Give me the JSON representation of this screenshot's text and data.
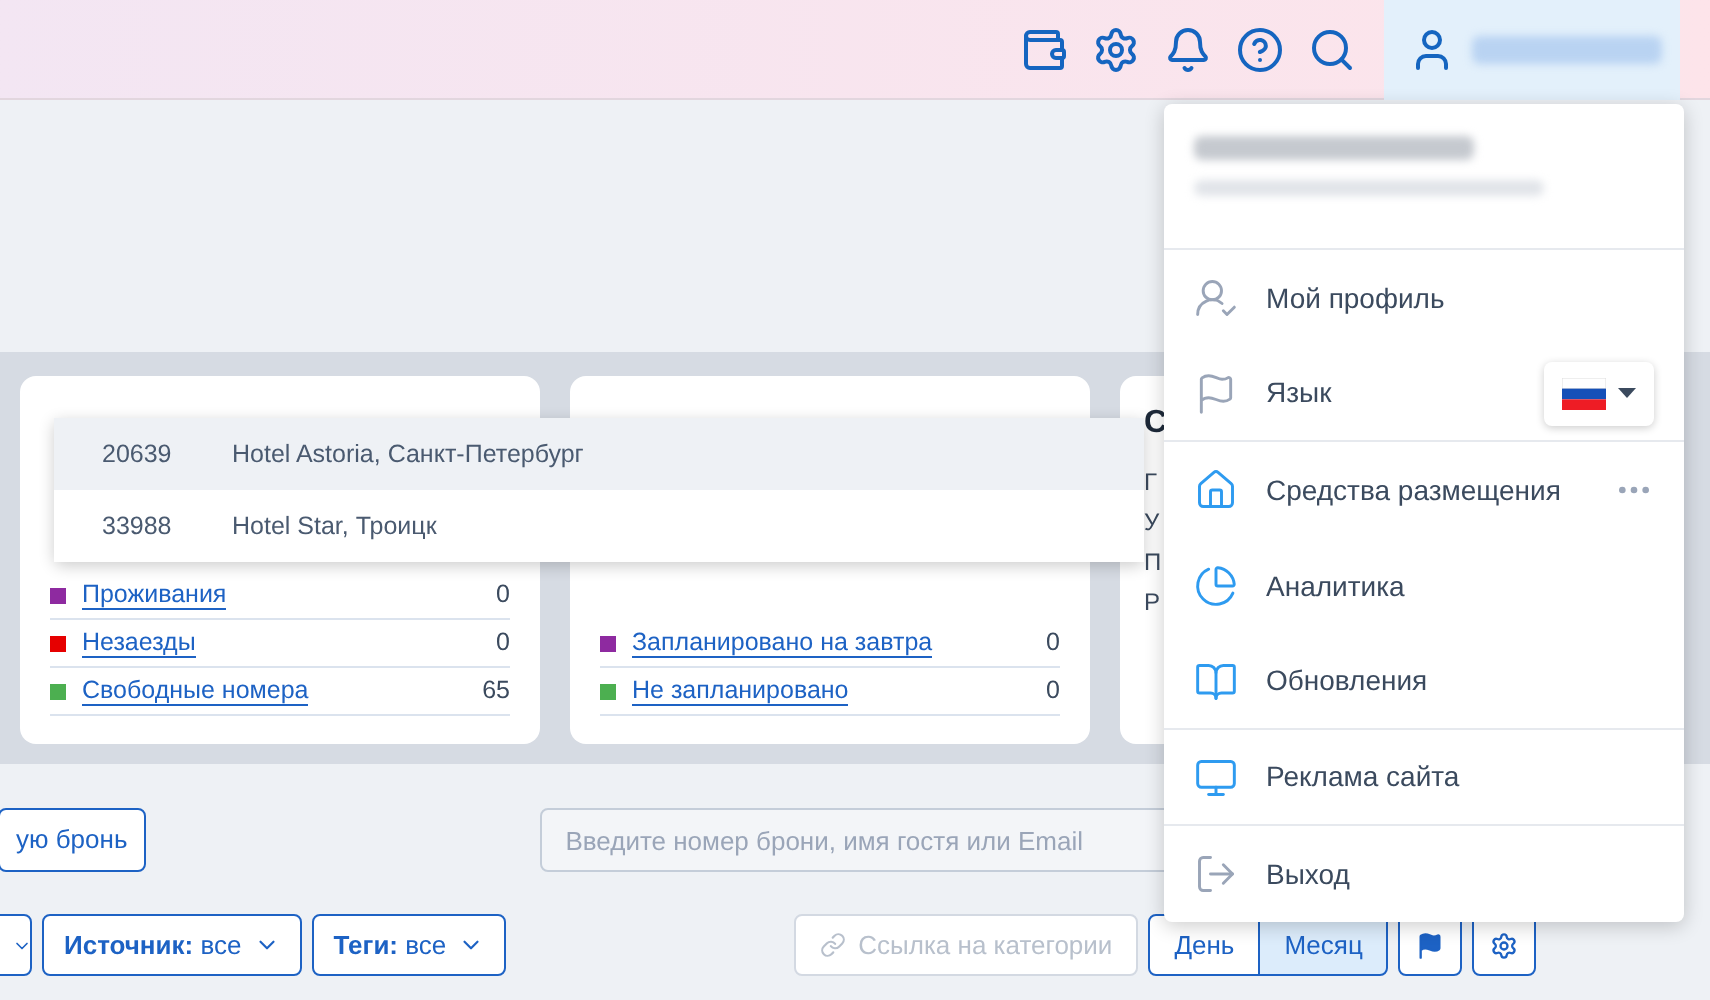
{
  "cards": [
    {
      "rows": [
        {
          "label": "Проживания",
          "value": "0",
          "color": "#8e2aa0"
        },
        {
          "label": "Незаезды",
          "value": "0",
          "color": "#e60000"
        },
        {
          "label": "Свободные номера",
          "value": "65",
          "color": "#4caf50"
        }
      ]
    },
    {
      "rows": [
        {
          "label": "Запланировано на завтра",
          "value": "0",
          "color": "#8e2aa0"
        },
        {
          "label": "Не запланировано",
          "value": "0",
          "color": "#4caf50"
        }
      ]
    }
  ],
  "card_3": {
    "title": "С",
    "lines": [
      "Г",
      "У",
      "П",
      "Р"
    ]
  },
  "hotel_dropdown": [
    {
      "id": "20639",
      "name": "Hotel Astoria, Санкт-Петербург",
      "selected": true
    },
    {
      "id": "33988",
      "name": "Hotel Star, Троицк",
      "selected": false
    }
  ],
  "new_booking_button": "ую бронь",
  "search": {
    "placeholder": "Введите номер брони, имя гостя или Email"
  },
  "filters": [
    {
      "label": "Источник:",
      "value": "все"
    },
    {
      "label": "Теги:",
      "value": "все"
    }
  ],
  "category_link_button": {
    "label": "Ссылка на категории",
    "disabled": true
  },
  "view_tabs": [
    {
      "label": "День",
      "selected": false
    },
    {
      "label": "Месяц",
      "selected": true
    }
  ],
  "user_menu": [
    {
      "kind": "item",
      "label": "Мой профиль"
    },
    {
      "kind": "language",
      "label": "Язык"
    },
    {
      "kind": "more",
      "label": "Средства размещения"
    },
    {
      "kind": "item",
      "label": "Аналитика"
    },
    {
      "kind": "item",
      "label": "Обновления"
    },
    {
      "kind": "item",
      "label": "Реклама сайта"
    },
    {
      "kind": "item",
      "label": "Выход"
    }
  ]
}
